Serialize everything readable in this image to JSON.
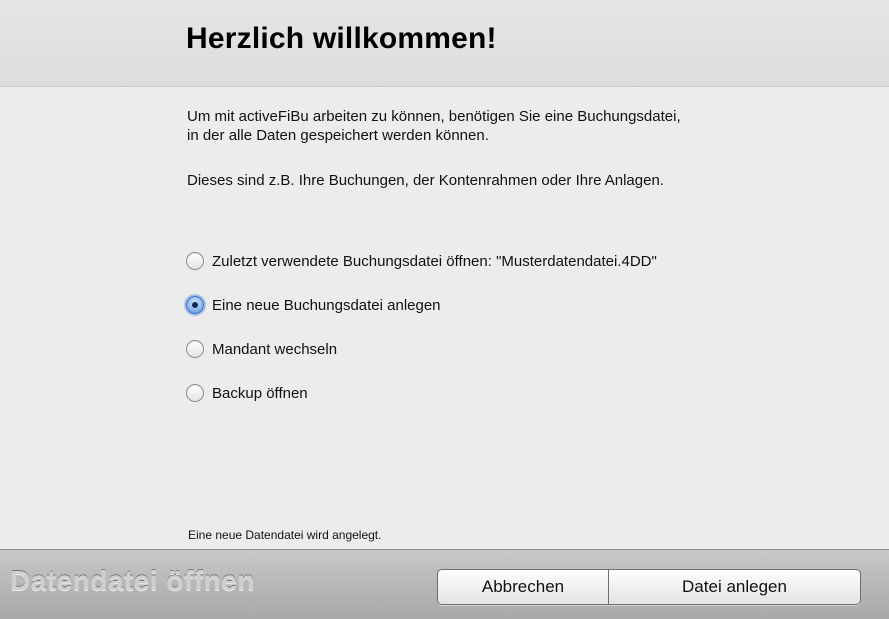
{
  "header": {
    "title": "Herzlich willkommen!"
  },
  "intro": {
    "line1": "Um mit activeFiBu arbeiten zu können, benötigen Sie eine Buchungsdatei,",
    "line2": "in der alle Daten gespeichert werden können.",
    "line3": "Dieses sind z.B. Ihre Buchungen, der Kontenrahmen oder Ihre Anlagen."
  },
  "options": [
    {
      "label": "Zuletzt verwendete Buchungsdatei öffnen: \"Musterdatendatei.4DD\"",
      "checked": false
    },
    {
      "label": "Eine neue Buchungsdatei anlegen",
      "checked": true
    },
    {
      "label": "Mandant wechseln",
      "checked": false
    },
    {
      "label": "Backup öffnen",
      "checked": false
    }
  ],
  "status": "Eine neue Datendatei wird angelegt.",
  "footer": {
    "title": "Datendatei öffnen",
    "cancel_label": "Abbrechen",
    "create_label": "Datei anlegen"
  },
  "colors": {
    "accent": "#5f93d9",
    "header_bg": "#e2e2e2",
    "footer_bg": "#b9b9b9"
  }
}
